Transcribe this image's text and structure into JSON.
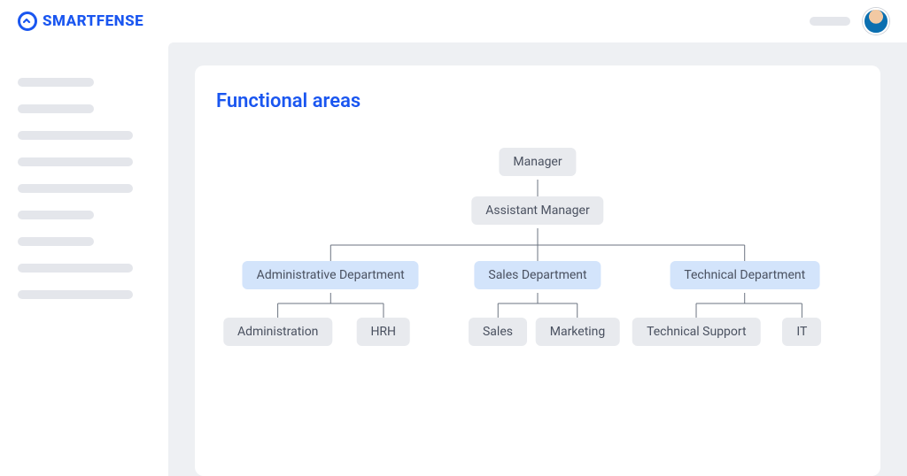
{
  "brand": {
    "name": "SMARTFENSE"
  },
  "page": {
    "title": "Functional areas"
  },
  "org": {
    "level0": {
      "label": "Manager"
    },
    "level1": {
      "label": "Assistant Manager"
    },
    "departments": [
      {
        "label": "Administrative Department",
        "children": [
          {
            "label": "Administration"
          },
          {
            "label": "HRH"
          }
        ]
      },
      {
        "label": "Sales Department",
        "children": [
          {
            "label": "Sales"
          },
          {
            "label": "Marketing"
          }
        ]
      },
      {
        "label": "Technical Department",
        "children": [
          {
            "label": "Technical Support"
          },
          {
            "label": "IT"
          }
        ]
      }
    ]
  }
}
